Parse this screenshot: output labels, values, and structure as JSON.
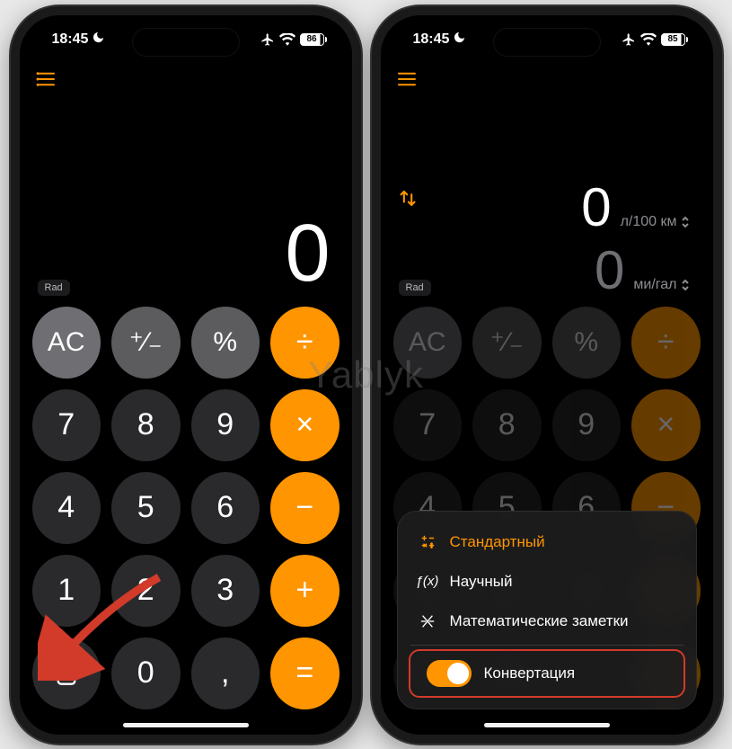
{
  "watermark": "Yablyk",
  "status": {
    "time": "18:45",
    "battery_left": "86",
    "battery_right": "85"
  },
  "calc": {
    "rad_label": "Rad",
    "display_value": "0",
    "keys": {
      "ac": "AC",
      "plusminus": "⁺⁄₋",
      "percent": "%",
      "divide": "÷",
      "k7": "7",
      "k8": "8",
      "k9": "9",
      "multiply": "×",
      "k4": "4",
      "k5": "5",
      "k6": "6",
      "minus": "−",
      "k1": "1",
      "k2": "2",
      "k3": "3",
      "plus": "+",
      "k0": "0",
      "decimal": ",",
      "equals": "="
    }
  },
  "conversion": {
    "top_value": "0",
    "top_unit": "л/100 км",
    "bottom_value": "0",
    "bottom_unit": "ми/гал"
  },
  "menu": {
    "standard": "Стандартный",
    "scientific": "Научный",
    "notes": "Математические заметки",
    "conversion": "Конвертация"
  }
}
